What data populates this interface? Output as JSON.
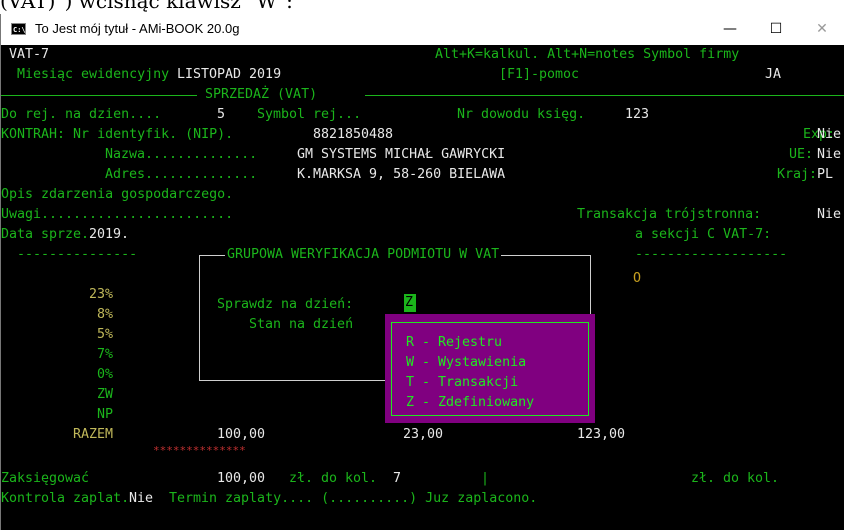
{
  "above_text": "(VAT)\") wcisnąć klawisz \"W\":",
  "window": {
    "title": "To Jest mój tytuł - AMi-BOOK 20.0g",
    "icon_label": "C:\\",
    "minimize": "—",
    "maximize": "☐",
    "close": "✕"
  },
  "term": {
    "form_name": "VAT-7",
    "hint_line": "Alt+K=kalkul. Alt+N=notes Symbol firmy",
    "month_label": "Miesiąc ewidencyjny",
    "month_value": "LISTOPAD 2019",
    "help": "[F1]-pomoc",
    "company_symbol": "JA",
    "section_title": "SPRZEDAŻ (VAT)",
    "reg_date_label": "Do rej. na dzien....",
    "reg_date_value": "5",
    "reg_symbol_label": "Symbol rej...",
    "doc_no_label": "Nr dowodu księg.",
    "doc_no_value": "123",
    "nip_label": "KONTRAH: Nr identyfik. (NIP).",
    "nip_value": "8821850488",
    "exp_label": "Exp:",
    "exp_value": "Nie",
    "name_label": "Nazwa..............",
    "name_value": "GM SYSTEMS MICHAŁ GAWRYCKI",
    "ue_label": "UE:",
    "ue_value": "Nie",
    "address_label": "Adres..............",
    "address_value": "K.MARKSA 9, 58-260 BIELAWA",
    "country_label": "Kraj:",
    "country_value": "PL",
    "event_desc_label": "Opis zdarzenia gospodarczego.",
    "notes_label": "Uwagi........................",
    "triangular_label": "Transakcja trójstronna:",
    "triangular_value": "Nie",
    "sale_date_label": "Data sprze.",
    "sale_date_value": "2019.",
    "section_c_label": "a sekcji C VAT-7:",
    "dash_left": "---------------",
    "dash_right": "-------------------",
    "o_marker": "O",
    "rates": [
      "23%",
      "8%",
      "5%",
      "7%",
      "0%",
      "ZW",
      "NP"
    ],
    "total_label": "RAZEM",
    "net_total": "100,00",
    "vat_total": "23,00",
    "gross_total": "123,00",
    "stars": "**************",
    "post_label": "Zaksięgować",
    "post_value": "100,00",
    "col_label": "zł. do kol.",
    "col_value": "7",
    "col_sep": "|",
    "col_label_right": "zł. do kol.",
    "payment_ctrl_label": "Kontrola zaplat.",
    "payment_ctrl_value": "Nie",
    "payment_term": "Termin zaplaty.... (..........) Juz zaplacono."
  },
  "dialog": {
    "title": "GRUPOWA WERYFIKACJA PODMIOTU W VAT",
    "check_date_label": "Sprawdz na dzień:",
    "check_date_value": "Z",
    "status_label": "Stan na dzień"
  },
  "popup": {
    "items": [
      "R - Rejestru",
      "W - Wystawienia",
      "T - Transakcji",
      "Z - Zdefiniowany"
    ]
  }
}
